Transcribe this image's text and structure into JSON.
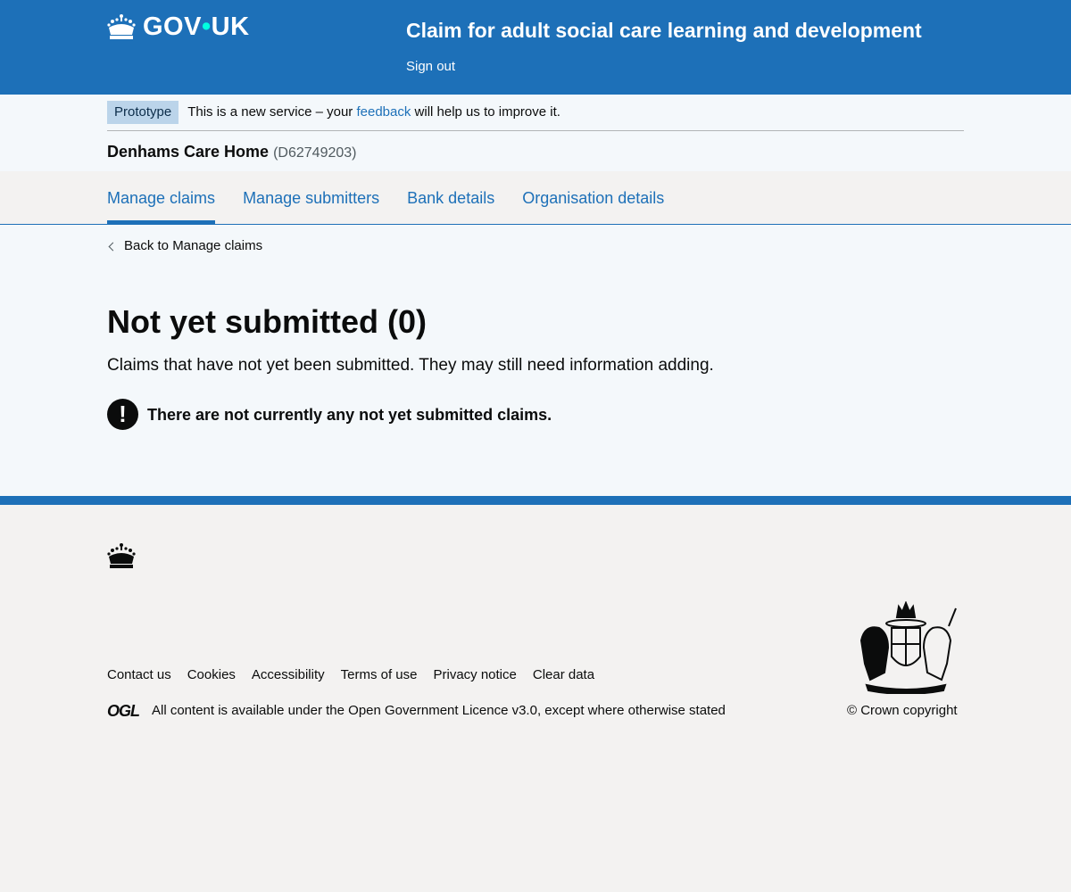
{
  "header": {
    "logo_text_left": "GOV",
    "logo_dot": "•",
    "logo_text_right": "UK",
    "service_name": "Claim for adult social care learning and development",
    "sign_out": "Sign out"
  },
  "phase_banner": {
    "tag": "Prototype",
    "text_before": "This is a new service – your",
    "link": "feedback",
    "text_after": "will help us to improve it."
  },
  "organisation": {
    "name": "Denhams Care Home",
    "code": "(D62749203)"
  },
  "tabs": [
    {
      "label": "Manage claims",
      "active": true
    },
    {
      "label": "Manage submitters",
      "active": false
    },
    {
      "label": "Bank details",
      "active": false
    },
    {
      "label": "Organisation details",
      "active": false
    }
  ],
  "back_link": "Back to Manage claims",
  "main": {
    "title": "Not yet submitted (0)",
    "lede": "Claims that have not yet been submitted. They may still need information adding.",
    "warning_icon": "!",
    "warning_text": "There are not currently any not yet submitted claims."
  },
  "footer": {
    "links": [
      "Contact us",
      "Cookies",
      "Accessibility",
      "Terms of use",
      "Privacy notice",
      "Clear data"
    ],
    "ogl_label": "OGL",
    "licence_before": "All content is available under the",
    "licence_link": "Open Government Licence v3.0",
    "licence_after": ", except where otherwise stated",
    "copyright": "© Crown copyright"
  },
  "colors": {
    "brand_blue": "#1d70b8",
    "text": "#0b0c0c",
    "phase_tag_bg": "#bbd4ea"
  },
  "icons": [
    "crown-icon",
    "chevron-left-icon",
    "warning-icon",
    "ogl-logo",
    "royal-crest"
  ]
}
